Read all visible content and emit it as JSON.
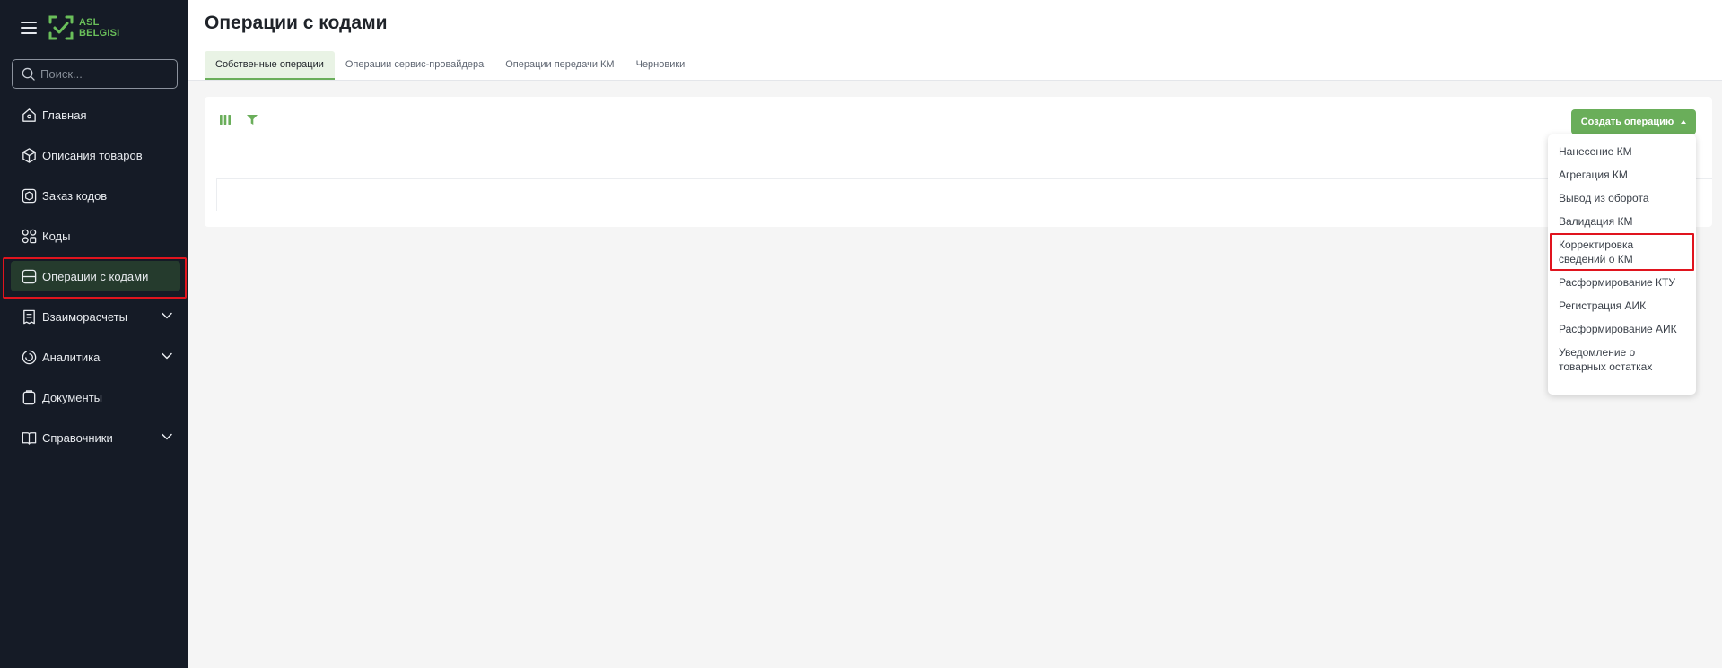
{
  "sidebar": {
    "logo_text_top": "ASL",
    "logo_text_bottom": "BELGISI",
    "search_placeholder": "Поиск...",
    "items": [
      {
        "label": "Главная",
        "icon": "home-icon"
      },
      {
        "label": "Описания товаров",
        "icon": "box-icon"
      },
      {
        "label": "Заказ кодов",
        "icon": "order-icon"
      },
      {
        "label": "Коды",
        "icon": "codes-icon"
      },
      {
        "label": "Операции с кодами",
        "icon": "operations-icon",
        "active": true
      },
      {
        "label": "Взаиморасчеты",
        "icon": "receipt-icon",
        "expandable": true
      },
      {
        "label": "Аналитика",
        "icon": "analytics-icon",
        "expandable": true
      },
      {
        "label": "Документы",
        "icon": "documents-icon"
      },
      {
        "label": "Справочники",
        "icon": "book-icon",
        "expandable": true
      }
    ]
  },
  "header": {
    "title": "Операции с кодами",
    "tabs": [
      {
        "label": "Собственные операции",
        "active": true
      },
      {
        "label": "Операции сервис-провайдера"
      },
      {
        "label": "Операции передачи КМ"
      },
      {
        "label": "Черновики"
      }
    ]
  },
  "toolbar": {
    "create_label": "Создать операцию"
  },
  "dropdown": {
    "items": [
      {
        "line1": "Нанесение КМ"
      },
      {
        "line1": "Агрегация КМ"
      },
      {
        "line1": "Вывод из оборота"
      },
      {
        "line1": "Валидация КМ"
      },
      {
        "line1": "Корректировка",
        "line2": "сведений о КМ",
        "highlighted": true
      },
      {
        "line1": "Расформирование КТУ"
      },
      {
        "line1": "Регистрация АИК"
      },
      {
        "line1": "Расформирование АИК"
      },
      {
        "line1": "Уведомление о",
        "line2": "товарных остатках"
      }
    ]
  },
  "colors": {
    "sidebar_bg": "#151b26",
    "accent": "#6aae5a",
    "highlight": "#e0141e"
  }
}
